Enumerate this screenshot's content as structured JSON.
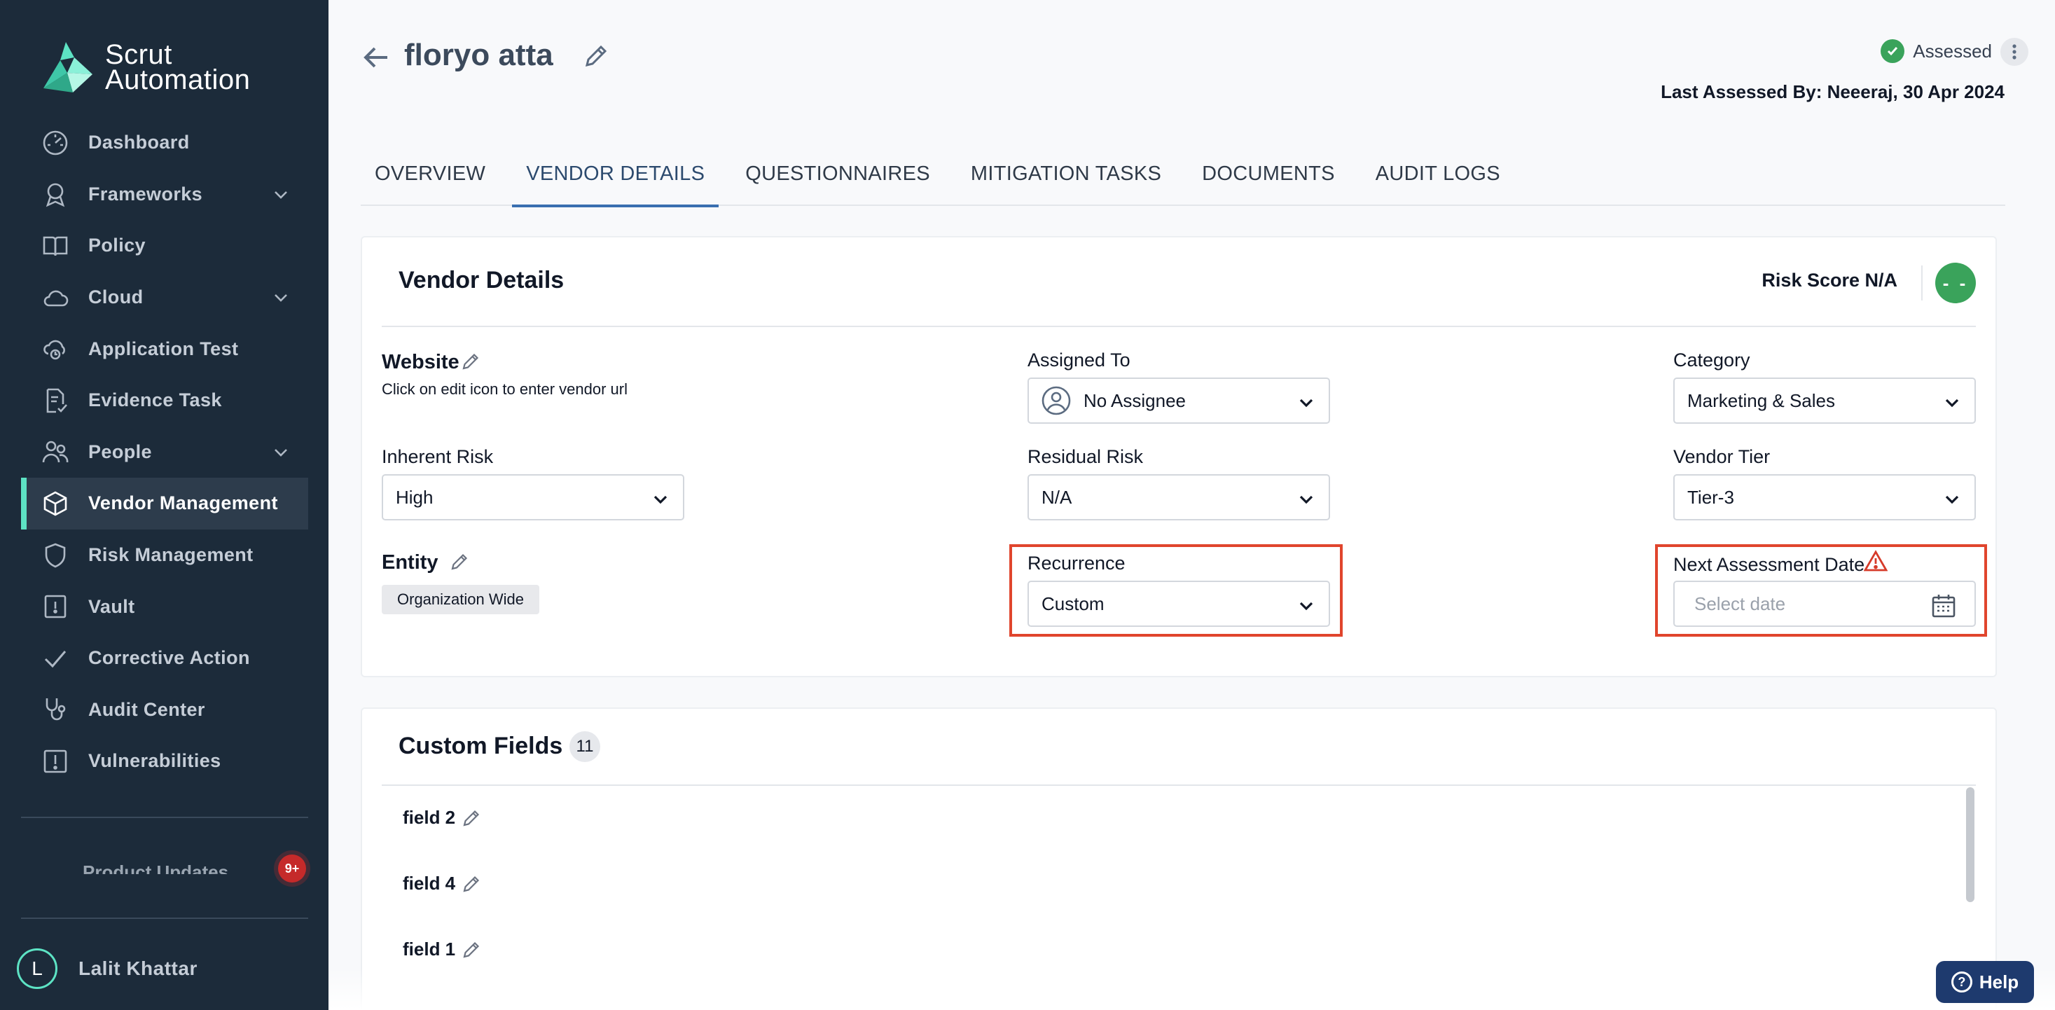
{
  "brand": {
    "line1": "Scrut",
    "line2": "Automation"
  },
  "sidebar": {
    "items": [
      {
        "label": "Dashboard",
        "icon": "dashboard-gauge-icon"
      },
      {
        "label": "Frameworks",
        "icon": "award-ribbon-icon",
        "expandable": true
      },
      {
        "label": "Policy",
        "icon": "book-open-icon"
      },
      {
        "label": "Cloud",
        "icon": "cloud-icon",
        "expandable": true
      },
      {
        "label": "Application Test",
        "icon": "cloud-sync-icon"
      },
      {
        "label": "Evidence Task",
        "icon": "document-check-icon"
      },
      {
        "label": "People",
        "icon": "people-icon",
        "expandable": true
      },
      {
        "label": "Vendor Management",
        "icon": "package-box-icon",
        "active": true
      },
      {
        "label": "Risk Management",
        "icon": "shield-icon"
      },
      {
        "label": "Vault",
        "icon": "vault-icon"
      },
      {
        "label": "Corrective Action",
        "icon": "checkmark-icon"
      },
      {
        "label": "Audit Center",
        "icon": "stethoscope-icon"
      },
      {
        "label": "Vulnerabilities",
        "icon": "alert-square-icon"
      }
    ],
    "product_updates_label": "Product Updates",
    "product_updates_badge": "9+",
    "user": {
      "initial": "L",
      "name": "Lalit Khattar"
    }
  },
  "header": {
    "vendor_name": "floryo atta",
    "status": "Assessed",
    "last_assessed": "Last Assessed By: Neeeraj, 30 Apr 2024"
  },
  "tabs": [
    {
      "label": "OVERVIEW"
    },
    {
      "label": "VENDOR DETAILS",
      "active": true
    },
    {
      "label": "QUESTIONNAIRES"
    },
    {
      "label": "MITIGATION TASKS"
    },
    {
      "label": "DOCUMENTS"
    },
    {
      "label": "AUDIT LOGS"
    }
  ],
  "vendor_details": {
    "title": "Vendor Details",
    "risk_score_label": "Risk Score N/A",
    "risk_score_value": "- -",
    "website_label": "Website",
    "website_hint": "Click on edit icon to enter vendor url",
    "assigned_to_label": "Assigned To",
    "assigned_to_value": "No Assignee",
    "category_label": "Category",
    "category_value": "Marketing & Sales",
    "inherent_risk_label": "Inherent Risk",
    "inherent_risk_value": "High",
    "residual_risk_label": "Residual Risk",
    "residual_risk_value": "N/A",
    "vendor_tier_label": "Vendor Tier",
    "vendor_tier_value": "Tier-3",
    "entity_label": "Entity",
    "entity_value": "Organization Wide",
    "recurrence_label": "Recurrence",
    "recurrence_value": "Custom",
    "next_assessment_label": "Next Assessment Date",
    "next_assessment_placeholder": "Select date"
  },
  "custom_fields": {
    "title": "Custom Fields",
    "count": "11",
    "fields": [
      "field 2",
      "field 4",
      "field 1"
    ]
  },
  "help_label": "Help",
  "colors": {
    "sidebar_bg": "#1c2b3a",
    "accent": "#5de3c4",
    "tab_active": "#3a6fb0",
    "highlight": "#e0452d",
    "success": "#3aa35b"
  }
}
